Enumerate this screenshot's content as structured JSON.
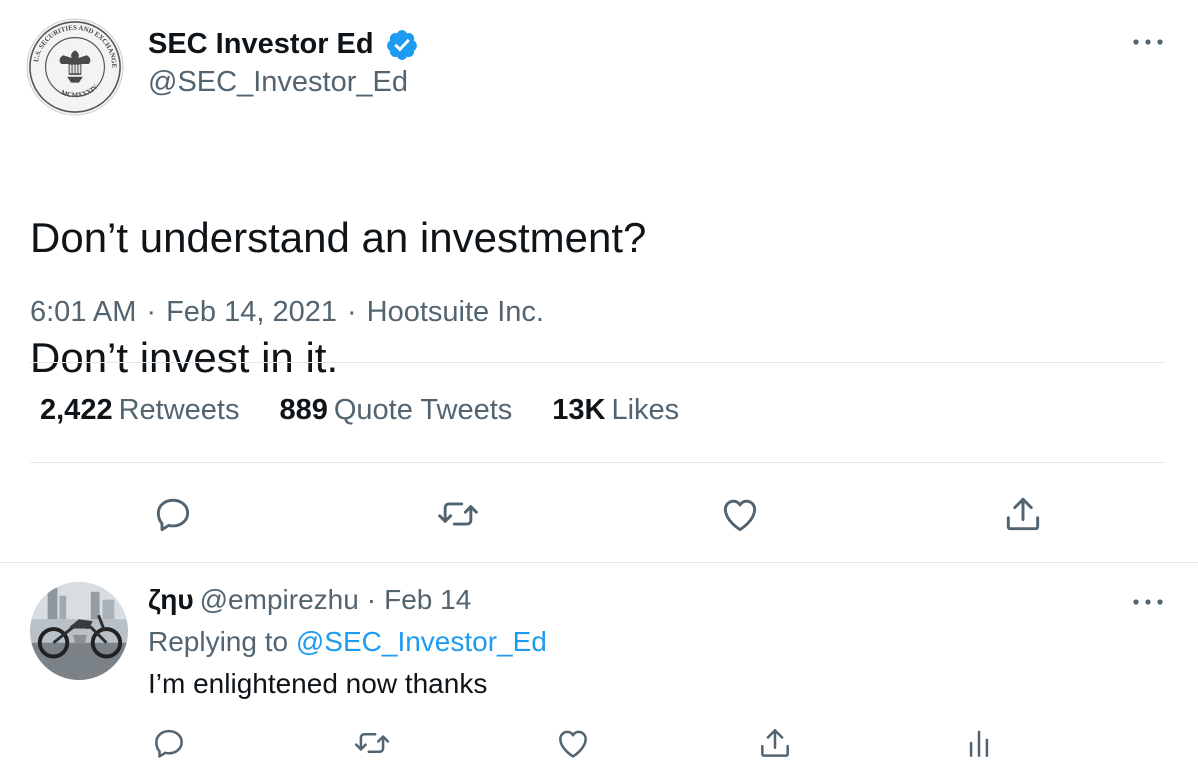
{
  "tweet": {
    "author": {
      "display_name": "SEC Investor Ed",
      "handle": "@SEC_Investor_Ed",
      "avatar_icon": "sec-seal",
      "verified": true,
      "seal_text_top": "U.S. SECURITIES AND EXCHANGE COMMISSION",
      "seal_text_bottom": "MCMXXXIV"
    },
    "text_line1": "Don’t understand an investment?",
    "text_line2": "Don’t invest in it.",
    "time": "6:01 AM",
    "date": "Feb 14, 2021",
    "source": "Hootsuite Inc.",
    "separator": "·",
    "stats": {
      "retweets_count": "2,422",
      "retweets_label": "Retweets",
      "quotes_count": "889",
      "quotes_label": "Quote Tweets",
      "likes_count": "13K",
      "likes_label": "Likes"
    },
    "actions": [
      "reply-icon",
      "retweet-icon",
      "like-icon",
      "share-icon"
    ],
    "more_icon": "more-icon"
  },
  "reply": {
    "display_name": "ζηυ",
    "handle": "@empirezhu",
    "separator": "·",
    "date": "Feb 14",
    "replying_prefix": "Replying to",
    "replying_to": "@SEC_Investor_Ed",
    "text": "I’m enlightened now thanks",
    "avatar_icon": "motorcycle-photo",
    "actions": [
      "reply-icon",
      "retweet-icon",
      "like-icon",
      "share-icon",
      "analytics-icon"
    ]
  },
  "colors": {
    "text": "#0f1419",
    "secondary": "#536471",
    "accent": "#1d9bf0",
    "divider": "#e5e9ec"
  }
}
